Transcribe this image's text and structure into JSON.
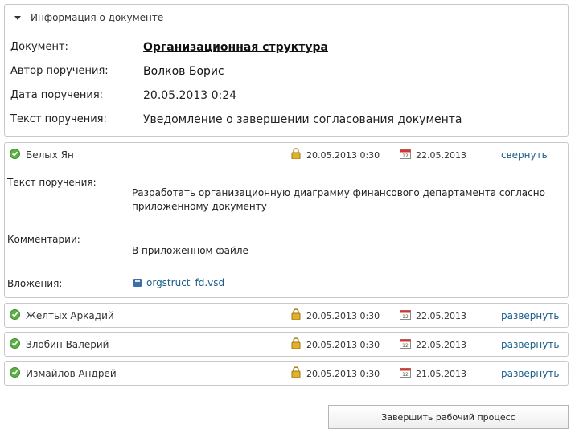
{
  "doc_info": {
    "header": "Информация о документе",
    "rows": [
      {
        "label": "Документ:",
        "value": "Организационная структура"
      },
      {
        "label": "Автор поручения:",
        "value": "Волков Борис"
      },
      {
        "label": "Дата поручения:",
        "value": "20.05.2013 0:24"
      },
      {
        "label": "Текст поручения:",
        "value": "Уведомление о завершении согласования документа"
      }
    ]
  },
  "tasks": [
    {
      "name": "Белых Ян",
      "date_locked": "20.05.2013 0:30",
      "date_due": "22.05.2013",
      "toggle": "свернуть",
      "details": {
        "text_label": "Текст поручения:",
        "text_value": "Разработать организационную диаграмму финансового департамента согласно приложенному документу",
        "comments_label": "Комментарии:",
        "comments_value": "В приложенном файле",
        "attachments_label": "Вложения:",
        "attachment_file": "orgstruct_fd.vsd"
      }
    },
    {
      "name": "Желтых Аркадий",
      "date_locked": "20.05.2013 0:30",
      "date_due": "22.05.2013",
      "toggle": "развернуть"
    },
    {
      "name": "Злобин Валерий",
      "date_locked": "20.05.2013 0:30",
      "date_due": "22.05.2013",
      "toggle": "развернуть"
    },
    {
      "name": "Измайлов Андрей",
      "date_locked": "20.05.2013 0:30",
      "date_due": "21.05.2013",
      "toggle": "развернуть"
    }
  ],
  "finish_button": "Завершить рабочий процесс",
  "icons": {
    "status": "check-circle-icon",
    "lock": "lock-icon",
    "calendar": "calendar-icon",
    "attachment": "floppy-disk-icon"
  },
  "colors": {
    "link": "#1a5e8a",
    "status_ok": "#5bb046",
    "border": "#c9c9c9"
  }
}
